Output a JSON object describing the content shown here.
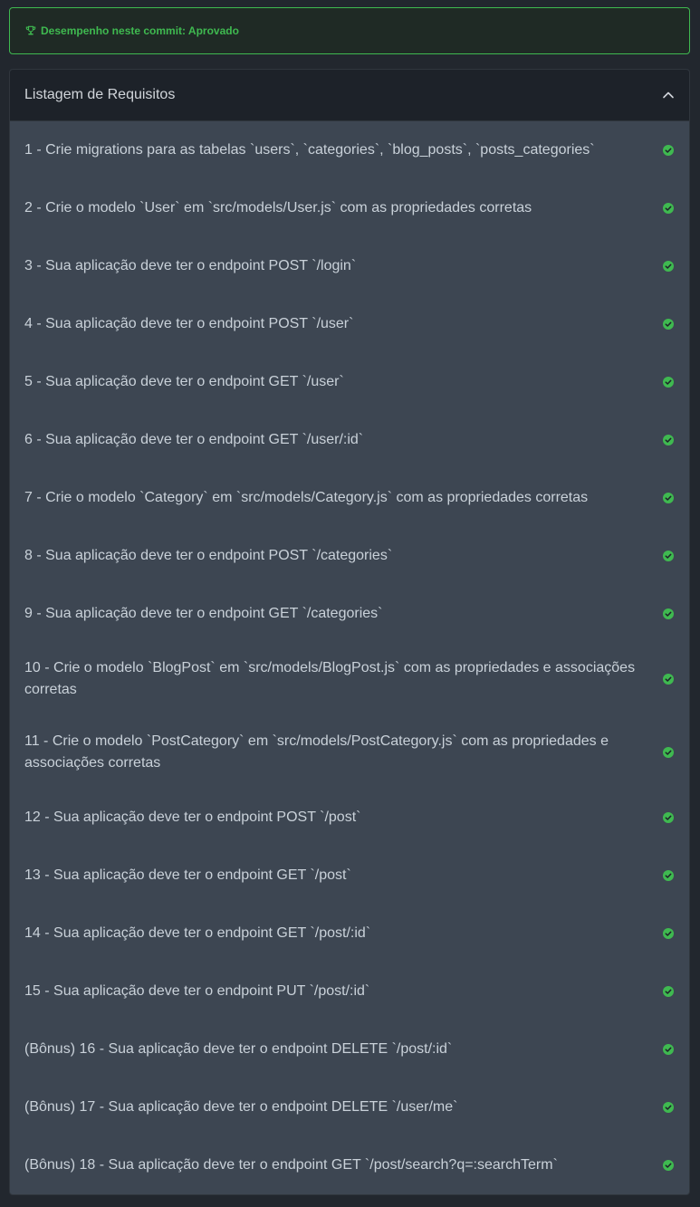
{
  "status": {
    "text": "Desempenho neste commit: Aprovado",
    "icon": "trophy-icon",
    "color": "#3fb950"
  },
  "panel": {
    "title": "Listagem de Requisitos",
    "toggle_icon": "chevron-up-icon"
  },
  "requirements": [
    {
      "label": "1 - Crie migrations para as tabelas `users`, `categories`, `blog_posts`, `posts_categories`",
      "status": "passed"
    },
    {
      "label": "2 - Crie o modelo `User` em `src/models/User.js` com as propriedades corretas",
      "status": "passed"
    },
    {
      "label": "3 - Sua aplicação deve ter o endpoint POST `/login`",
      "status": "passed"
    },
    {
      "label": "4 - Sua aplicação deve ter o endpoint POST `/user`",
      "status": "passed"
    },
    {
      "label": "5 - Sua aplicação deve ter o endpoint GET `/user`",
      "status": "passed"
    },
    {
      "label": "6 - Sua aplicação deve ter o endpoint GET `/user/:id`",
      "status": "passed"
    },
    {
      "label": "7 - Crie o modelo `Category` em `src/models/Category.js` com as propriedades corretas",
      "status": "passed"
    },
    {
      "label": "8 - Sua aplicação deve ter o endpoint POST `/categories`",
      "status": "passed"
    },
    {
      "label": "9 - Sua aplicação deve ter o endpoint GET `/categories`",
      "status": "passed"
    },
    {
      "label": "10 - Crie o modelo `BlogPost` em `src/models/BlogPost.js` com as propriedades e associações corretas",
      "status": "passed"
    },
    {
      "label": "11 - Crie o modelo `PostCategory` em `src/models/PostCategory.js` com as propriedades e associações corretas",
      "status": "passed"
    },
    {
      "label": "12 - Sua aplicação deve ter o endpoint POST `/post`",
      "status": "passed"
    },
    {
      "label": "13 - Sua aplicação deve ter o endpoint GET `/post`",
      "status": "passed"
    },
    {
      "label": "14 - Sua aplicação deve ter o endpoint GET `/post/:id`",
      "status": "passed"
    },
    {
      "label": "15 - Sua aplicação deve ter o endpoint PUT `/post/:id`",
      "status": "passed"
    },
    {
      "label": "(Bônus) 16 - Sua aplicação deve ter o endpoint DELETE `/post/:id`",
      "status": "passed"
    },
    {
      "label": "(Bônus) 17 - Sua aplicação deve ter o endpoint DELETE `/user/me`",
      "status": "passed"
    },
    {
      "label": "(Bônus) 18 - Sua aplicação deve ter o endpoint GET `/post/search?q=:searchTerm`",
      "status": "passed"
    }
  ],
  "colors": {
    "check": "#3fb950"
  }
}
